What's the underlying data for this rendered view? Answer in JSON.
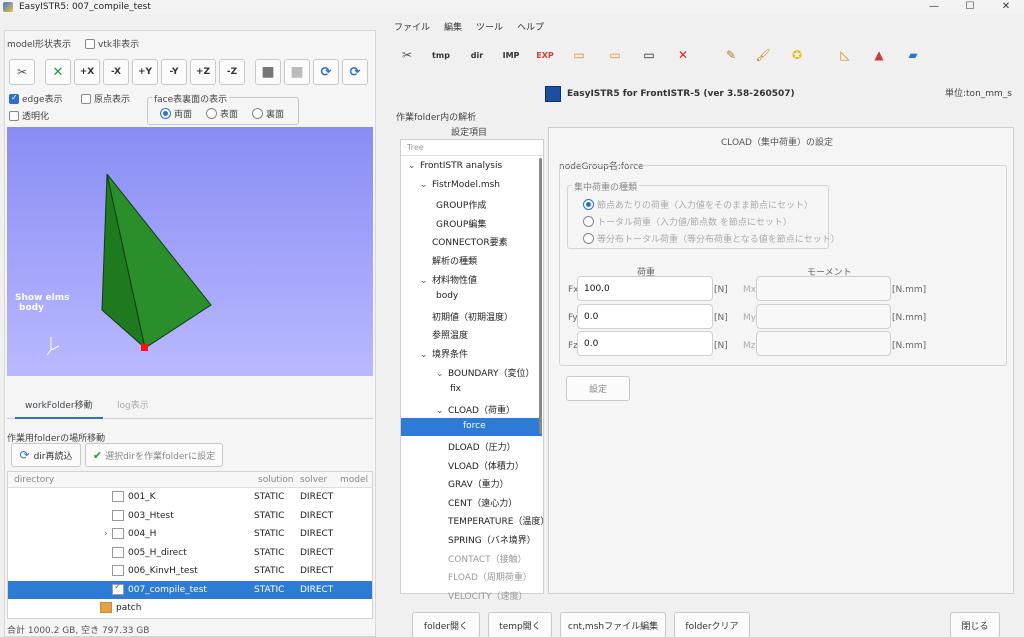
{
  "window": {
    "title": "EasyISTR5: 007_compile_test",
    "controls": [
      "—",
      "☐",
      "✕"
    ]
  },
  "left": {
    "model_label": "model形状表示",
    "vtk_hide": "vtk非表示",
    "view_buttons": [
      "✂",
      "✕",
      "+X",
      "-X",
      "+Y",
      "-Y",
      "+Z",
      "-Z",
      "■",
      "■",
      "⟳",
      "⟳"
    ],
    "edge_display": "edge表示",
    "origin_display": "原点表示",
    "transparent": "透明化",
    "face_group": "face表裏面の表示",
    "face_opts": [
      "両面",
      "表面",
      "裏面"
    ],
    "viewport_label_1": "Show elms",
    "viewport_label_2": "body",
    "tabs": [
      "workFolder移動",
      "log表示"
    ],
    "move_label": "作業用folderの場所移動",
    "reload_btn": "dir再読込",
    "set_btn": "選択dirを作業folderに設定",
    "table_headers": [
      "directory",
      "solution",
      "solver",
      "model"
    ],
    "rows": [
      {
        "name": "001_K",
        "solution": "STATIC",
        "solver": "DIRECT"
      },
      {
        "name": "003_Htest",
        "solution": "STATIC",
        "solver": "DIRECT"
      },
      {
        "name": "004_H",
        "solution": "STATIC",
        "solver": "DIRECT"
      },
      {
        "name": "005_H_direct",
        "solution": "STATIC",
        "solver": "DIRECT"
      },
      {
        "name": "006_KinvH_test",
        "solution": "STATIC",
        "solver": "DIRECT"
      },
      {
        "name": "007_compile_test",
        "solution": "STATIC",
        "solver": "DIRECT"
      },
      {
        "name": "patch",
        "solution": "",
        "solver": ""
      }
    ],
    "status": "合計 1000.2 GB, 空き 797.33 GB"
  },
  "menu": [
    "ファイル",
    "編集",
    "ツール",
    "ヘルプ"
  ],
  "toolbar": [
    "✂",
    "tmp",
    "dir",
    "IMP",
    "EXP",
    "▭",
    "▭",
    "▭",
    "✕",
    "✎",
    "🖌",
    "✪",
    "◺",
    "▲",
    "▰"
  ],
  "banner": "EasyISTR5 for FrontISTR-5  (ver 3.58-260507)",
  "units": "単位:ton_mm_s",
  "work_label": "作業folder内の解析",
  "settings_label": "設定項目",
  "tree": {
    "header": "Tree",
    "nodes": [
      {
        "label": "FrontISTR analysis",
        "arrow": "⌄"
      },
      {
        "label": "FistrModel.msh",
        "arrow": "⌄"
      },
      {
        "label": "GROUP作成",
        "arrow": ""
      },
      {
        "label": "GROUP編集",
        "arrow": ""
      },
      {
        "label": "CONNECTOR要素",
        "arrow": ""
      },
      {
        "label": "解析の種類",
        "arrow": ""
      },
      {
        "label": "材料物性値",
        "arrow": "⌄"
      },
      {
        "label": "body",
        "arrow": ""
      },
      {
        "label": "初期値（初期温度）",
        "arrow": ""
      },
      {
        "label": "参照温度",
        "arrow": ""
      },
      {
        "label": "境界条件",
        "arrow": "⌄"
      },
      {
        "label": "BOUNDARY（変位）",
        "arrow": "⌄"
      },
      {
        "label": "fix",
        "arrow": ""
      },
      {
        "label": "CLOAD（荷重）",
        "arrow": "⌄"
      },
      {
        "label": "force",
        "arrow": ""
      },
      {
        "label": "DLOAD（圧力）",
        "arrow": ""
      },
      {
        "label": "VLOAD（体積力）",
        "arrow": ""
      },
      {
        "label": "GRAV（重力）",
        "arrow": ""
      },
      {
        "label": "CENT（遠心力）",
        "arrow": ""
      },
      {
        "label": "TEMPERATURE（温度）",
        "arrow": ""
      },
      {
        "label": "SPRING（バネ境界）",
        "arrow": ""
      },
      {
        "label": "CONTACT（接触）",
        "arrow": ""
      },
      {
        "label": "FLOAD（周期荷重）",
        "arrow": ""
      },
      {
        "label": "VELOCITY（速度）",
        "arrow": ""
      }
    ]
  },
  "cload": {
    "title": "CLOAD（集中荷重）の設定",
    "node_group": "nodeGroup名:force",
    "type_label": "集中荷重の種類",
    "types": [
      "節点あたりの荷重（入力値をそのまま節点にセット）",
      "トータル荷重（入力値/節点数 を節点にセット）",
      "等分布トータル荷重（等分布荷重となる値を節点にセット）"
    ],
    "load_label": "荷重",
    "moment_label": "モーメント",
    "fx_label": "Fx",
    "fy_label": "Fy",
    "fz_label": "Fz",
    "mx_label": "Mx",
    "my_label": "My",
    "mz_label": "Mz",
    "fx": "100.0",
    "fy": "0.0",
    "fz": "0.0",
    "unit_n": "[N]",
    "unit_nmm": "[N.mm]",
    "set_btn": "設定"
  },
  "bottom_buttons": [
    "folder開く",
    "temp開く",
    "cnt,mshファイル編集",
    "folderクリア",
    "閉じる"
  ]
}
